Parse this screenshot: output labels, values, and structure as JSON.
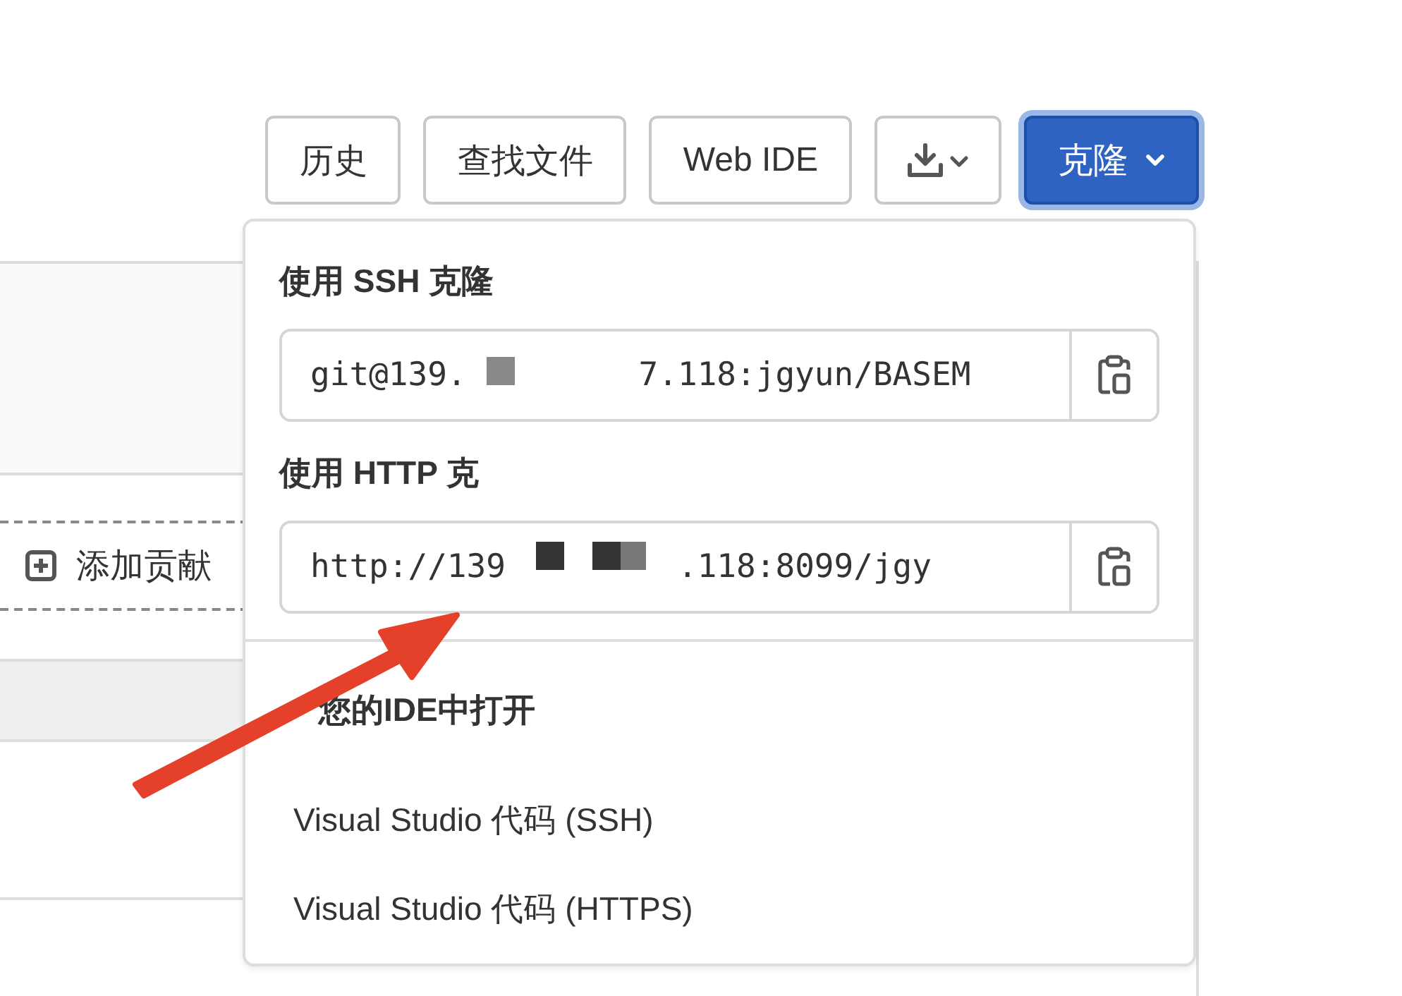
{
  "toolbar": {
    "buttons": [
      {
        "kind": "text",
        "label": "历史",
        "primary": false
      },
      {
        "kind": "text",
        "label": "查找文件",
        "primary": false
      },
      {
        "kind": "text",
        "label": "Web IDE",
        "primary": false
      },
      {
        "kind": "download",
        "primary": false
      },
      {
        "kind": "dropdown",
        "label": "克隆",
        "primary": true
      }
    ]
  },
  "background": {
    "add_contributor": "添加贡献"
  },
  "clone_menu": {
    "sections": [
      {
        "title": "使用 SSH 克隆",
        "url_parts": [
          "git@139.",
          "7.118:jgyun/BASEM"
        ]
      },
      {
        "title": "使用 HTTP 克",
        "url_parts": [
          "http://139",
          ".118:8099/jgy"
        ]
      }
    ],
    "ide": {
      "title": "您的IDE中打开",
      "items": [
        "Visual Studio 代码 (SSH)",
        "Visual Studio 代码 (HTTPS)"
      ]
    }
  }
}
